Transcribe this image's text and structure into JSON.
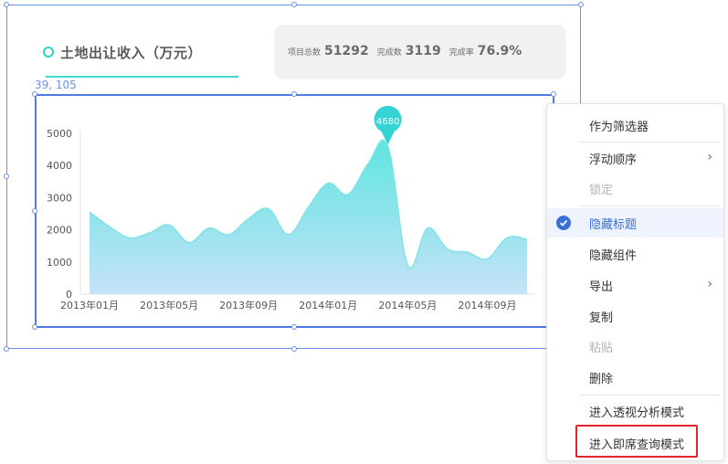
{
  "widget": {
    "title": "土地出让收入（万元）",
    "coord_text": "39, 105",
    "stats": [
      {
        "label": "项目总数",
        "value": "51292"
      },
      {
        "label": "完成数",
        "value": "3119"
      },
      {
        "label": "完成率",
        "value": "76.9%"
      }
    ]
  },
  "chart_data": {
    "type": "area",
    "x_tick_labels": [
      "2013年01月",
      "2013年05月",
      "2013年09月",
      "2014年01月",
      "2014年05月",
      "2014年09月"
    ],
    "y_tick_labels": [
      "0",
      "1000",
      "2000",
      "3000",
      "4000",
      "5000"
    ],
    "ylim": [
      0,
      5000
    ],
    "months": [
      "2013-01",
      "2013-02",
      "2013-03",
      "2013-04",
      "2013-05",
      "2013-06",
      "2013-07",
      "2013-08",
      "2013-09",
      "2013-10",
      "2013-11",
      "2013-12",
      "2014-01",
      "2014-02",
      "2014-03",
      "2014-04",
      "2014-05",
      "2014-06",
      "2014-07",
      "2014-08",
      "2014-09",
      "2014-10",
      "2014-11"
    ],
    "values": [
      2550,
      2100,
      1750,
      1900,
      2150,
      1600,
      2050,
      1850,
      2350,
      2650,
      1850,
      2700,
      3450,
      3100,
      4050,
      4600,
      900,
      2050,
      1400,
      1300,
      1100,
      1750,
      1700
    ],
    "peak_label": "4680",
    "colors": {
      "area_top": "#5ee4e0",
      "area_bottom": "#c5e3f7",
      "line": "#7fe2e6",
      "pin": "#33d3d6"
    }
  },
  "context_menu": {
    "items": [
      {
        "label": "作为筛选器",
        "state": "normal",
        "submenu": false
      },
      {
        "label": "浮动顺序",
        "state": "normal",
        "submenu": true
      },
      {
        "label": "锁定",
        "state": "disabled",
        "submenu": false
      },
      {
        "label": "隐藏标题",
        "state": "checked",
        "submenu": false
      },
      {
        "label": "隐藏组件",
        "state": "normal",
        "submenu": false
      },
      {
        "label": "导出",
        "state": "normal",
        "submenu": true
      },
      {
        "label": "复制",
        "state": "normal",
        "submenu": false
      },
      {
        "label": "粘贴",
        "state": "disabled",
        "submenu": false
      },
      {
        "label": "删除",
        "state": "normal",
        "submenu": false
      },
      {
        "label": "进入透视分析模式",
        "state": "normal",
        "submenu": false
      },
      {
        "label": "进入即席查询模式",
        "state": "highlighted",
        "submenu": false
      }
    ],
    "check_icon": "check-circle-icon",
    "arrow_icon": "chevron-right-icon",
    "highlight_color": "#e0262b"
  }
}
